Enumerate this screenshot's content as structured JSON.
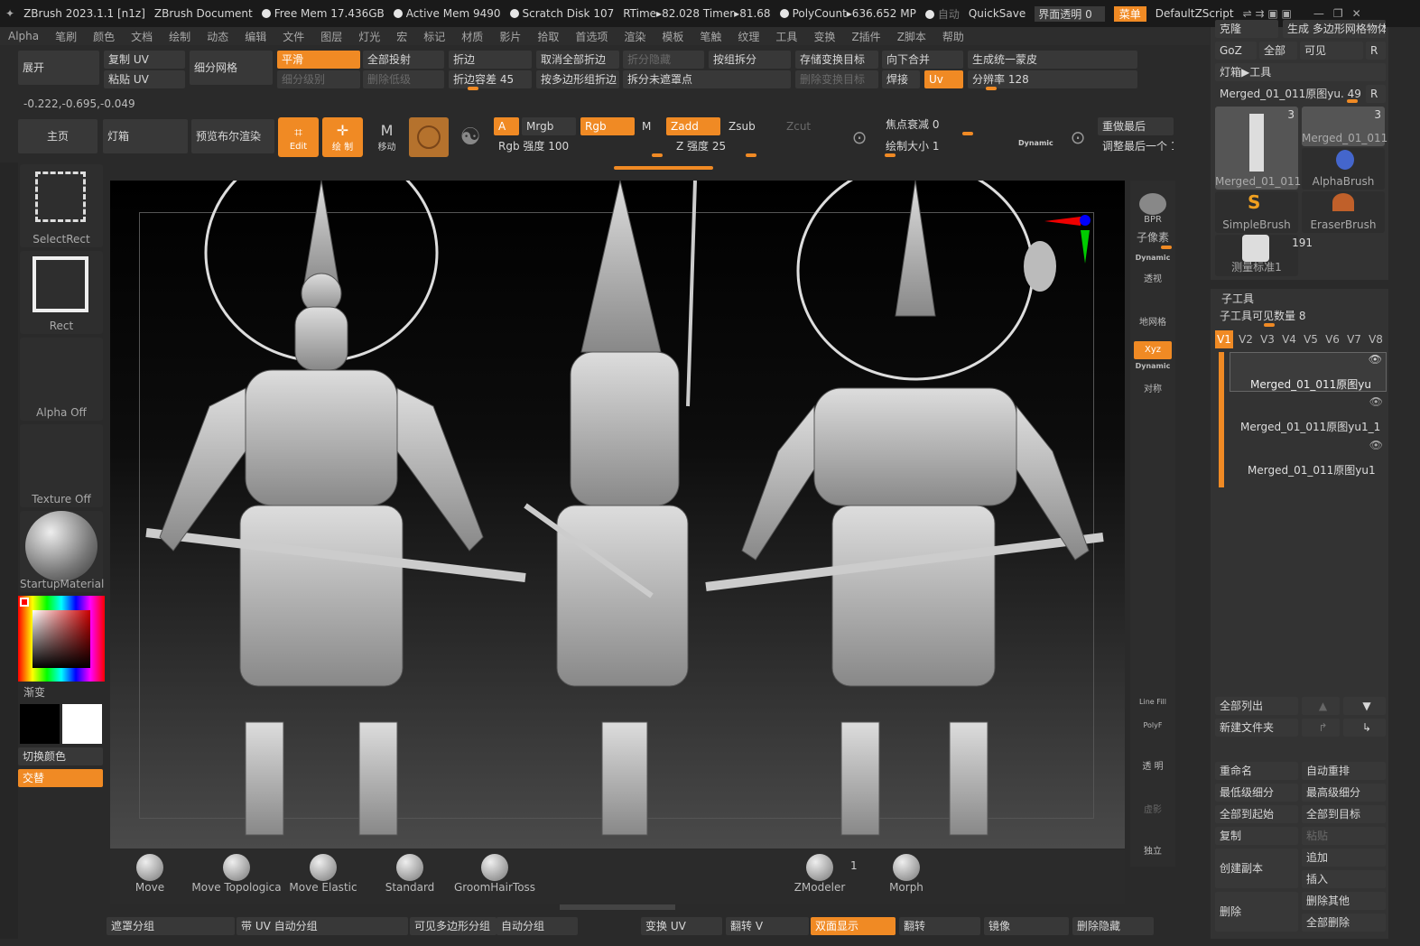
{
  "window": {
    "title": "ZBrush 2023.1.1 [n1z]",
    "doc": "ZBrush Document",
    "free_mem": "Free Mem 17.436GB",
    "active_mem": "Active Mem 9490",
    "scratch": "Scratch Disk 107",
    "rtime": "RTime▸82.028 Timer▸81.68",
    "polycount": "PolyCount▸636.652 MP",
    "auto": "自动",
    "quicksave": "QuickSave",
    "transparency": "界面透明 0",
    "menu": "菜单",
    "script": "DefaultZScript"
  },
  "menubar": [
    "Alpha",
    "笔刷",
    "颜色",
    "文档",
    "绘制",
    "动态",
    "编辑",
    "文件",
    "图层",
    "灯光",
    "宏",
    "标记",
    "材质",
    "影片",
    "拾取",
    "首选项",
    "渲染",
    "模板",
    "笔触",
    "纹理",
    "工具",
    "变换",
    "Z插件",
    "Z脚本",
    "帮助"
  ],
  "toolbar1": {
    "unwrap": "展开",
    "copy_uv": "复制 UV",
    "paste_uv": "粘贴 UV",
    "subdiv": "细分网格",
    "smooth": "平滑",
    "subdiv_level": "细分级别",
    "project_all": "全部投射",
    "del_lower": "删除低级",
    "crease": "折边",
    "crease_tol": "折边容差 45",
    "uncrease_all": "取消全部折边",
    "crease_pg": "按多边形组折边",
    "split_hidden": "折分隐藏",
    "split_unmasked": "拆分未遮罩点",
    "split_groups": "按组拆分",
    "store_morph": "存储变换目标",
    "del_morph": "删除变换目标",
    "merge_down": "向下合并",
    "weld": "焊接",
    "uv": "Uv",
    "unify_skin": "生成统一蒙皮",
    "resolution": "分辨率 128"
  },
  "coords": "-0.222,-0.695,-0.049",
  "toolbar2": {
    "home": "主页",
    "lightbox": "灯箱",
    "bpr_preview": "预览布尔渲染",
    "edit": "Edit",
    "draw": "绘 制",
    "move": "移动",
    "a": "A",
    "mrgb": "Mrgb",
    "rgb": "Rgb",
    "m": "M",
    "zadd": "Zadd",
    "zsub": "Zsub",
    "zcut": "Zcut",
    "rgb_int": "Rgb 强度 100",
    "z_int": "Z 强度 25",
    "focal": "焦点衰减 0",
    "draw_size": "绘制大小 1",
    "dynamic": "Dynamic",
    "redo_last": "重做最后",
    "redo_last_one": "调整最后一个 1"
  },
  "leftpanel": {
    "select_rect": "SelectRect",
    "rect": "Rect",
    "alpha_off": "Alpha Off",
    "texture_off": "Texture Off",
    "material": "StartupMaterial",
    "gradient": "渐变",
    "switch_color": "切换颜色",
    "alternate": "交替"
  },
  "rightshelf": {
    "bpr": "BPR",
    "subpixel": "子像素",
    "dynamic": "Dynamic",
    "persp": "透视",
    "floor": "地网格",
    "xyz": "Xyz",
    "sym": "对称",
    "linefill": "Line Fill",
    "polyf": "PolyF",
    "transp": "透 明",
    "ghost": "虚影",
    "solo": "独立"
  },
  "toolpanel": {
    "clone": "克隆",
    "make_polymesh": "生成 多边形网格物体",
    "goz": "GoZ",
    "all": "全部",
    "visible": "可见",
    "r": "R",
    "lightbox_tool": "灯箱▶工具",
    "current": "Merged_01_011原图yu. 49",
    "r2": "R",
    "tools": [
      {
        "name": "Merged_01_011",
        "count": "3"
      },
      {
        "name": "Merged_01_011",
        "count": "3"
      },
      {
        "name": "AlphaBrush",
        "count": ""
      },
      {
        "name": "SimpleBrush",
        "count": ""
      },
      {
        "name": "EraserBrush",
        "count": ""
      },
      {
        "name": "测量标准1",
        "count": "191"
      }
    ]
  },
  "subtool": {
    "title": "子工具",
    "visible_count": "子工具可见数量 8",
    "tabs": [
      "V1",
      "V2",
      "V3",
      "V4",
      "V5",
      "V6",
      "V7",
      "V8"
    ],
    "items": [
      "Merged_01_011原图yu",
      "Merged_01_011原图yu1_1",
      "Merged_01_011原图yu1"
    ],
    "list_all": "全部列出",
    "new_folder": "新建文件夹",
    "rename": "重命名",
    "auto_reorder": "自动重排",
    "lowest": "最低级细分",
    "highest": "最高级细分",
    "all_start": "全部到起始",
    "all_target": "全部到目标",
    "copy": "复制",
    "paste": "粘贴",
    "duplicate": "创建副本",
    "append": "追加",
    "insert": "插入",
    "delete": "删除",
    "del_other": "删除其他",
    "del_all": "全部删除"
  },
  "brushes": [
    "Move",
    "Move Topologica",
    "Move Elastic",
    "Standard",
    "GroomHairToss",
    "ZModeler",
    "Morph"
  ],
  "zmodeler_count": "1",
  "bottombar": [
    "遮罩分组",
    "带 UV 自动分组",
    "可见多边形分组",
    "自动分组",
    "变换 UV",
    "翻转 V",
    "双面显示",
    "翻转",
    "镜像",
    "删除隐藏"
  ],
  "colors": {
    "accent": "#f08a24",
    "bg": "#2a2a2a"
  }
}
